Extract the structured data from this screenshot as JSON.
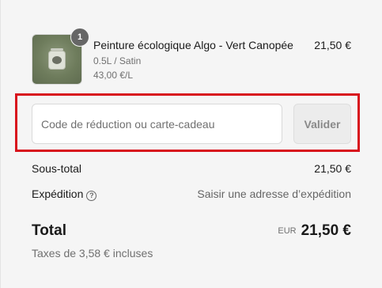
{
  "product": {
    "quantity": "1",
    "name": "Peinture écologique Algo - Vert Canopée",
    "variant": "0.5L / Satin",
    "unit_price": "43,00 €/L",
    "price": "21,50 €",
    "thumbnail_icon": "paint-can-icon"
  },
  "discount": {
    "placeholder": "Code de réduction ou carte-cadeau",
    "value": "",
    "apply_label": "Valider",
    "highlight_color": "#d8121d"
  },
  "summary": {
    "subtotal_label": "Sous-total",
    "subtotal_value": "21,50 €",
    "shipping_label": "Expédition",
    "shipping_help_icon": "help-circle-icon",
    "shipping_value": "Saisir une adresse d’expédition",
    "total_label": "Total",
    "currency": "EUR",
    "total_value": "21,50 €",
    "taxes_note": "Taxes de 3,58 € incluses"
  }
}
